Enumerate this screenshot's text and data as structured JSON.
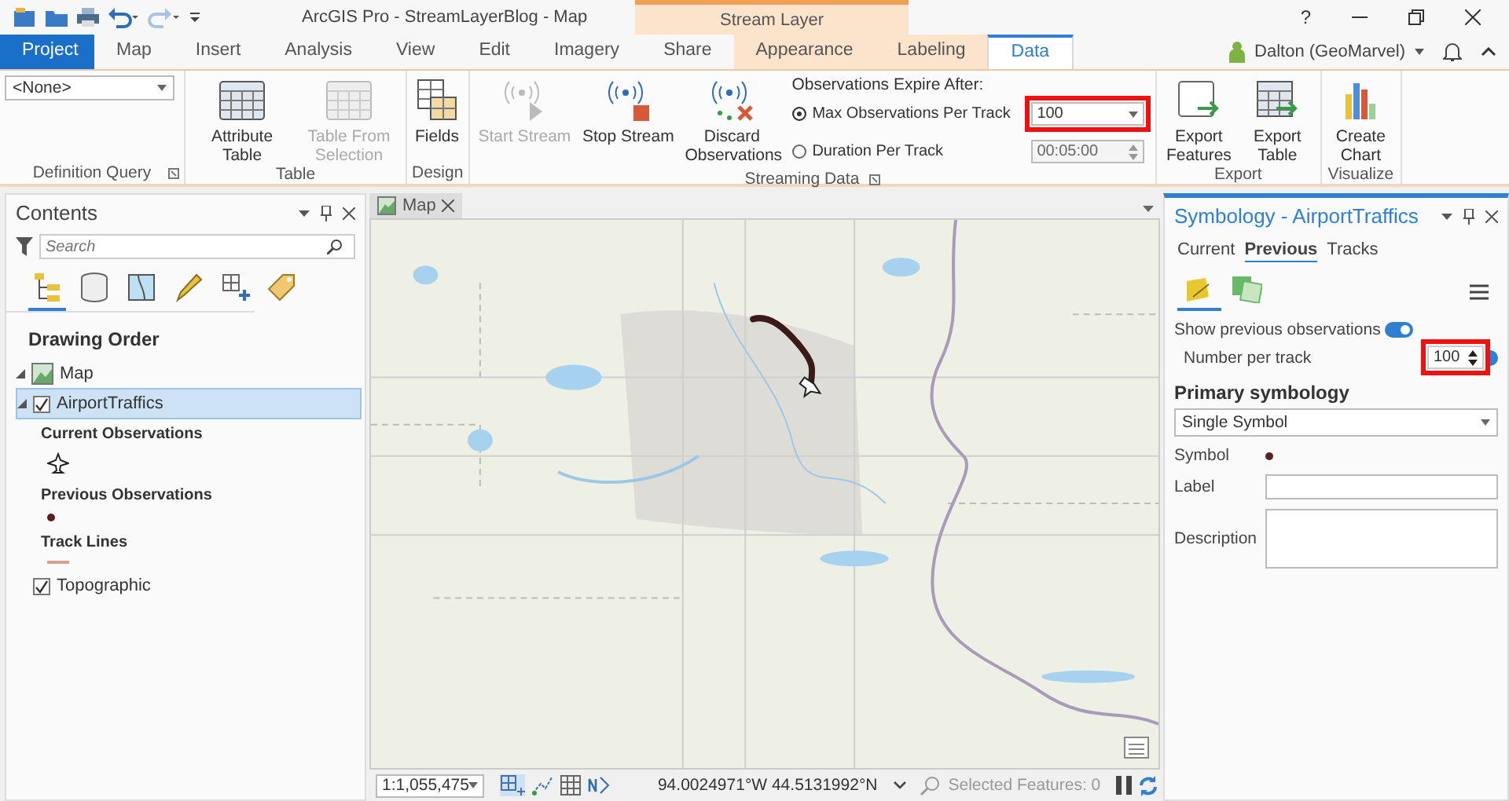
{
  "title_bar": {
    "title": "ArcGIS Pro - StreamLayerBlog - Map",
    "context_group": "Stream Layer",
    "help": "?"
  },
  "tabs": [
    {
      "label": "Project",
      "kind": "file",
      "selected": false
    },
    {
      "label": "Map",
      "kind": "core",
      "selected": false
    },
    {
      "label": "Insert",
      "kind": "core",
      "selected": false
    },
    {
      "label": "Analysis",
      "kind": "core",
      "selected": false
    },
    {
      "label": "View",
      "kind": "core",
      "selected": false
    },
    {
      "label": "Edit",
      "kind": "core",
      "selected": false
    },
    {
      "label": "Imagery",
      "kind": "core",
      "selected": false
    },
    {
      "label": "Share",
      "kind": "core",
      "selected": false
    },
    {
      "label": "Appearance",
      "kind": "context",
      "selected": false
    },
    {
      "label": "Labeling",
      "kind": "context",
      "selected": false
    },
    {
      "label": "Data",
      "kind": "context",
      "selected": true
    }
  ],
  "user": {
    "name": "Dalton (GeoMarvel)"
  },
  "ribbon": {
    "definition_query": {
      "label": "Definition Query",
      "dropdown": "<None>"
    },
    "table": {
      "label": "Table",
      "buttons": [
        {
          "label": "Attribute Table",
          "disabled": false
        },
        {
          "label": "Table From Selection",
          "disabled": true
        }
      ]
    },
    "design": {
      "label": "Design",
      "buttons": [
        {
          "label": "Fields",
          "disabled": false
        }
      ]
    },
    "streaming_data": {
      "label": "Streaming Data",
      "buttons": [
        {
          "label": "Start Stream",
          "disabled": true
        },
        {
          "label": "Stop Stream",
          "disabled": false
        },
        {
          "label": "Discard Observations",
          "disabled": false
        }
      ],
      "expire_label": "Observations Expire After:",
      "options": [
        {
          "label": "Max Observations Per Track",
          "selected": true,
          "value": "100",
          "highlighted": true
        },
        {
          "label": "Duration Per Track",
          "selected": false,
          "value": "00:05:00",
          "highlighted": false
        }
      ]
    },
    "export": {
      "label": "Export",
      "buttons": [
        {
          "label": "Export Features"
        },
        {
          "label": "Export Table"
        }
      ]
    },
    "visualize": {
      "label": "Visualize",
      "buttons": [
        {
          "label": "Create Chart"
        }
      ]
    }
  },
  "contents": {
    "title": "Contents",
    "search": {
      "placeholder": "Search"
    },
    "views": [
      {
        "selected": true
      },
      {
        "selected": false
      },
      {
        "selected": false
      },
      {
        "selected": false
      },
      {
        "selected": false
      },
      {
        "selected": false
      }
    ],
    "heading": "Drawing Order",
    "tree": [
      {
        "label": "Map",
        "expanded": true,
        "children": [
          {
            "label": "AirportTraffics",
            "checked": true,
            "selected": true,
            "expanded": true,
            "legend": [
              {
                "heading": "Current Observations",
                "kind": "plane"
              },
              {
                "heading": "Previous Observations",
                "kind": "dot"
              },
              {
                "heading": "Track Lines",
                "kind": "line"
              }
            ]
          },
          {
            "label": "Topographic",
            "checked": true,
            "selected": false
          }
        ]
      }
    ]
  },
  "map_view": {
    "tab": "Map",
    "scale": "1:1,055,475",
    "coordinates": "94.0024971°W 44.5131992°N",
    "selected_features": "Selected Features: 0"
  },
  "symbology": {
    "title": "Symbology - AirportTraffics",
    "tabs": [
      {
        "label": "Current",
        "selected": false
      },
      {
        "label": "Previous",
        "selected": true
      },
      {
        "label": "Tracks",
        "selected": false
      }
    ],
    "icon_tabs": [
      {
        "selected": true
      },
      {
        "selected": false
      }
    ],
    "show_previous": {
      "label": "Show previous observations",
      "on": true
    },
    "number_per_track": {
      "label": "Number per track",
      "value": "100",
      "highlighted": true
    },
    "primary_heading": "Primary symbology",
    "primary_value": "Single Symbol",
    "symbol_label": "Symbol",
    "label_label": "Label",
    "description_label": "Description"
  }
}
